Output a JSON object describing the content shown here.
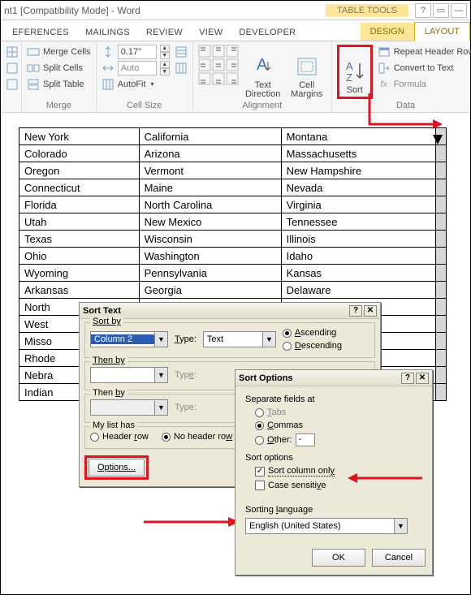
{
  "titlebar": {
    "title": "nt1 [Compatibility Mode] - Word",
    "table_tools": "TABLE TOOLS"
  },
  "tabs": {
    "references": "EFERENCES",
    "mailings": "MAILINGS",
    "review": "REVIEW",
    "view": "VIEW",
    "developer": "DEVELOPER",
    "design": "DESIGN",
    "layout": "LAYOUT"
  },
  "ribbon": {
    "merge": {
      "merge_cells": "Merge Cells",
      "split_cells": "Split Cells",
      "split_table": "Split Table",
      "label": "Merge"
    },
    "cellsize": {
      "height_val": "0.17\"",
      "width_empty": "",
      "autofit": "AutoFit",
      "label": "Cell Size",
      "auto": "Auto"
    },
    "alignment": {
      "text_direction_l1": "Text",
      "text_direction_l2": "Direction",
      "cell_margins_l1": "Cell",
      "cell_margins_l2": "Margins",
      "label": "Alignment"
    },
    "data": {
      "sort": "Sort",
      "repeat": "Repeat Header Row",
      "convert": "Convert to Text",
      "formula": "Formula",
      "label": "Data",
      "fx": "fx"
    }
  },
  "table_rows": [
    [
      "New York",
      "California",
      "Montana"
    ],
    [
      "Colorado",
      "Arizona",
      "Massachusetts"
    ],
    [
      "Oregon",
      "Vermont",
      "New Hampshire"
    ],
    [
      "Connecticut",
      "Maine",
      "Nevada"
    ],
    [
      "Florida",
      "North Carolina",
      "Virginia"
    ],
    [
      "Utah",
      "New Mexico",
      "Tennessee"
    ],
    [
      "Texas",
      "Wisconsin",
      "Illinois"
    ],
    [
      "Ohio",
      "Washington",
      "Idaho"
    ],
    [
      "Wyoming",
      "Pennsylvania",
      "Kansas"
    ],
    [
      "Arkansas",
      "Georgia",
      "Delaware"
    ],
    [
      "North",
      "",
      ""
    ],
    [
      "West",
      "",
      ""
    ],
    [
      "Misso",
      "",
      ""
    ],
    [
      "Rhode",
      "",
      ""
    ],
    [
      "Nebra",
      "",
      ""
    ],
    [
      "Indian",
      "",
      ""
    ]
  ],
  "sort_text": {
    "title": "Sort Text",
    "sort_by": "Sort by",
    "then_by": "Then by",
    "then_by2": "Then by",
    "type": "Type:",
    "column2": "Column 2",
    "text_type": "Text",
    "ascending": "Ascending",
    "descending": "Descending",
    "mylist": "My list has",
    "header_row": "Header row",
    "no_header_row": "No header row",
    "options": "Options..."
  },
  "sort_options": {
    "title": "Sort Options",
    "separate": "Separate fields at",
    "tabs": "Tabs",
    "commas": "Commas",
    "other": "Other:",
    "sort_opts": "Sort options",
    "col_only": "Sort column only",
    "case_sens": "Case sensitive",
    "sort_lang": "Sorting language",
    "lang": "English (United States)",
    "ok": "OK",
    "cancel": "Cancel"
  }
}
